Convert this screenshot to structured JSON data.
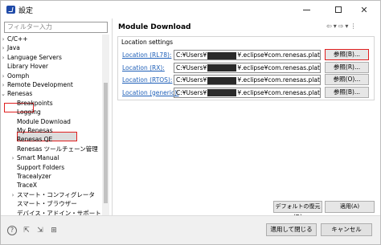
{
  "window": {
    "title": "設定"
  },
  "filter": {
    "placeholder": "フィルター入力"
  },
  "tree": [
    {
      "label": "C/C++",
      "chevron": "›"
    },
    {
      "label": "Java",
      "chevron": "›"
    },
    {
      "label": "Language Servers",
      "chevron": "›"
    },
    {
      "label": "Library Hover",
      "chevron": ""
    },
    {
      "label": "Oomph",
      "chevron": "›"
    },
    {
      "label": "Remote Development",
      "chevron": "›"
    },
    {
      "label": "Renesas",
      "chevron": "⌄"
    },
    {
      "label": "Breakpoints",
      "chevron": ""
    },
    {
      "label": "Logging",
      "chevron": ""
    },
    {
      "label": "Module Download",
      "chevron": ""
    },
    {
      "label": "My Renesas",
      "chevron": ""
    },
    {
      "label": "Renesas QE",
      "chevron": ""
    },
    {
      "label": "Renesas ツールチェーン管理",
      "chevron": ""
    },
    {
      "label": "Smart Manual",
      "chevron": "›"
    },
    {
      "label": "Support Folders",
      "chevron": ""
    },
    {
      "label": "Tracealyzer",
      "chevron": ""
    },
    {
      "label": "TraceX",
      "chevron": ""
    },
    {
      "label": "スマート・コンフィグレータ",
      "chevron": "›"
    },
    {
      "label": "スマート・ブラウザー",
      "chevron": ""
    },
    {
      "label": "デバイス・アドイン・サポート",
      "chevron": ""
    }
  ],
  "page": {
    "title": "Module Download",
    "group_label": "Location settings",
    "locations": [
      {
        "label": "Location (RL78):",
        "path_prefix": "C:¥Users¥",
        "path_suffix": "¥.eclipse¥com.renesas.platform_d",
        "button": "参照(B)..."
      },
      {
        "label": "Location (RX):",
        "path_prefix": "C:¥Users¥",
        "path_suffix": "¥.eclipse¥com.renesas.platform_d",
        "button": "参照(R)..."
      },
      {
        "label": "Location (RTOS):",
        "path_prefix": "C:¥Users¥",
        "path_suffix": "¥.eclipse¥com.renesas.platform_d",
        "button": "参照(O)..."
      },
      {
        "label": "Location (generic):",
        "path_prefix": "C:¥Users¥",
        "path_suffix": "¥.eclipse¥com.renesas.platform_d",
        "button": "参照(B)..."
      }
    ],
    "restore_defaults": "デフォルトの復元(D)",
    "apply": "適用(A)"
  },
  "footer": {
    "apply_close": "適用して閉じる",
    "cancel": "キャンセル"
  },
  "colors": {
    "highlight": "#e02020",
    "link": "#1e5fb8"
  }
}
